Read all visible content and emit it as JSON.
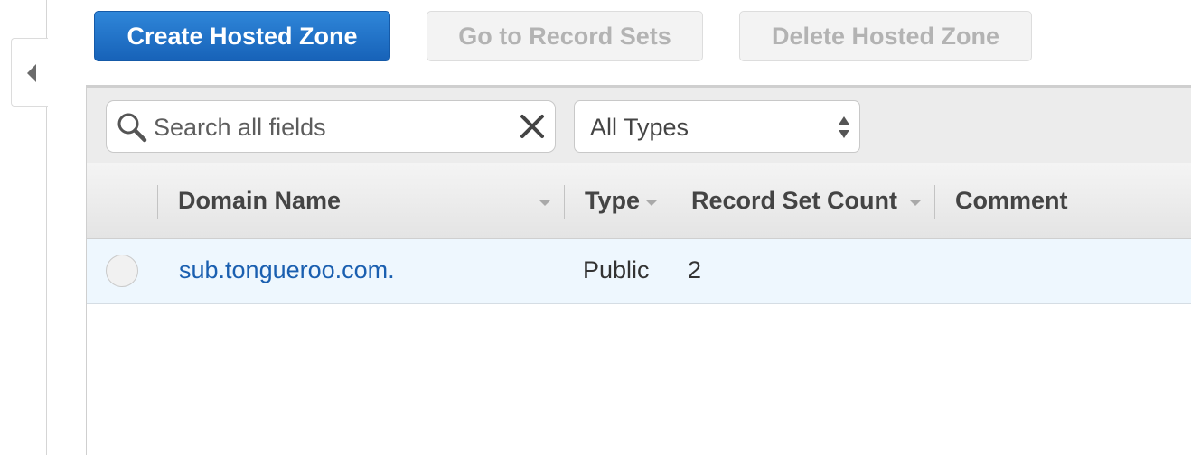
{
  "toolbar": {
    "create_label": "Create Hosted Zone",
    "goto_label": "Go to Record Sets",
    "delete_label": "Delete Hosted Zone"
  },
  "filters": {
    "search_placeholder": "Search all fields",
    "search_value": "",
    "type_selected": "All Types"
  },
  "table": {
    "columns": [
      "Domain Name",
      "Type",
      "Record Set Count",
      "Comment"
    ],
    "rows": [
      {
        "domain": "sub.tongueroo.com.",
        "type": "Public",
        "count": "2",
        "comment": ""
      }
    ]
  },
  "colors": {
    "primary": "#1f70c8",
    "link": "#1a5fb0",
    "row_highlight": "#eef7fe"
  },
  "icons": [
    "collapse-left-icon",
    "search-icon",
    "clear-icon",
    "select-arrows-icon",
    "sort-caret-icon"
  ]
}
